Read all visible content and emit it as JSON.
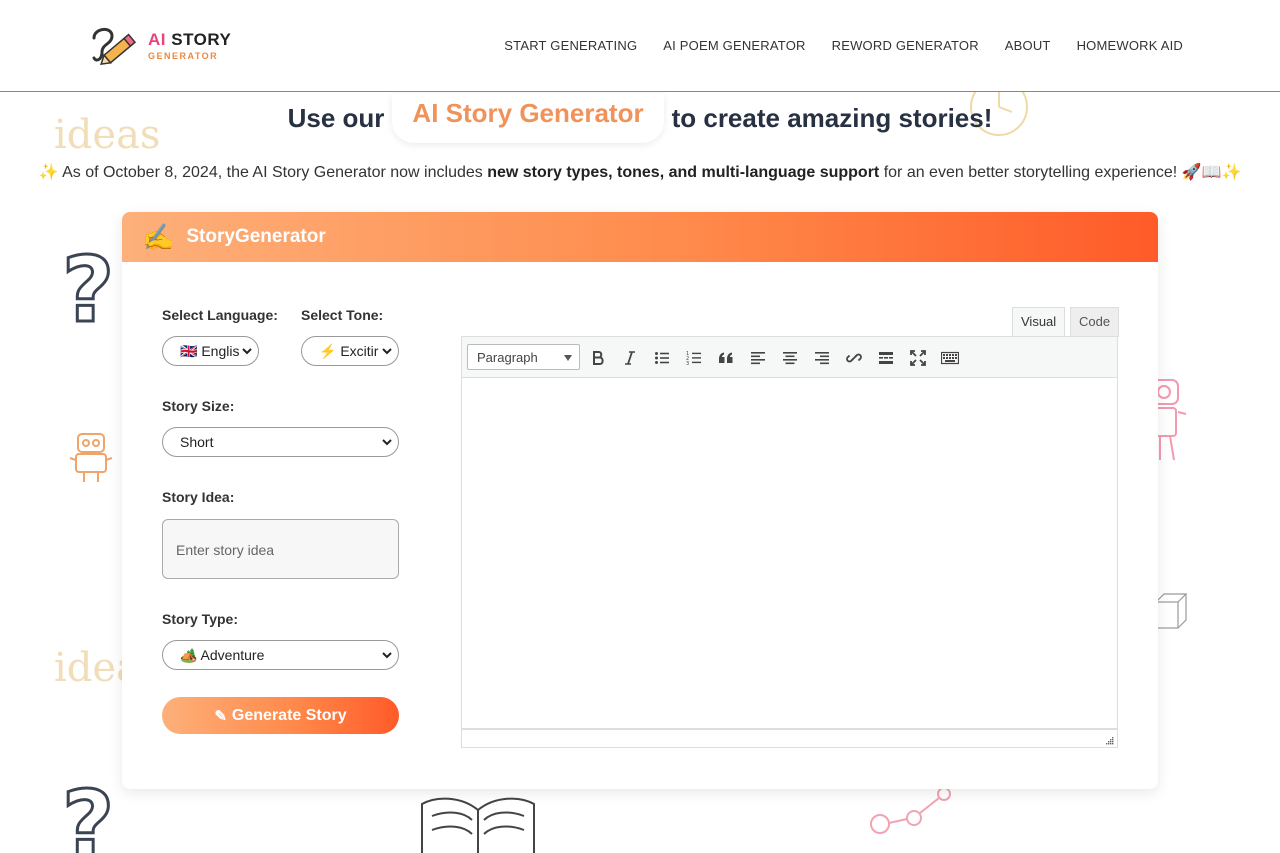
{
  "header": {
    "logo_title_ai": "AI",
    "logo_title_rest": "STORY",
    "logo_sub": "GENERATOR",
    "nav": [
      {
        "label": "START GENERATING"
      },
      {
        "label": "AI POEM GENERATOR"
      },
      {
        "label": "REWORD GENERATOR"
      },
      {
        "label": "ABOUT"
      },
      {
        "label": "HOMEWORK AID"
      }
    ]
  },
  "hero": {
    "prefix": "Use our",
    "highlight": "AI Story Generator",
    "suffix": "to create amazing stories!"
  },
  "announcement": {
    "sparkle_left": "✨",
    "text_before": "As of October 8, 2024, the AI Story Generator now includes ",
    "bold": "new story types, tones, and multi-language support",
    "text_after": " for an even better storytelling experience! ",
    "emojis_end": "🚀📖✨"
  },
  "card": {
    "pen_emoji": "✍️",
    "title": "StoryGenerator"
  },
  "form": {
    "language_label": "Select Language:",
    "language_value": "🇬🇧 Englis",
    "tone_label": "Select Tone:",
    "tone_value": "⚡ Excitir",
    "size_label": "Story Size:",
    "size_value": "Short",
    "idea_label": "Story Idea:",
    "idea_placeholder": "Enter story idea",
    "type_label": "Story Type:",
    "type_value": "🏕️ Adventure",
    "generate_label": "Generate Story"
  },
  "editor": {
    "tab_visual": "Visual",
    "tab_code": "Code",
    "format_value": "Paragraph"
  },
  "background": {
    "ideas_text": "ideas"
  },
  "colors": {
    "accent_orange": "#ff8a4b",
    "gradient_start": "#fdb07a",
    "gradient_end": "#ff5b28",
    "headline_highlight": "#f0935a",
    "headline_text": "#273142"
  }
}
